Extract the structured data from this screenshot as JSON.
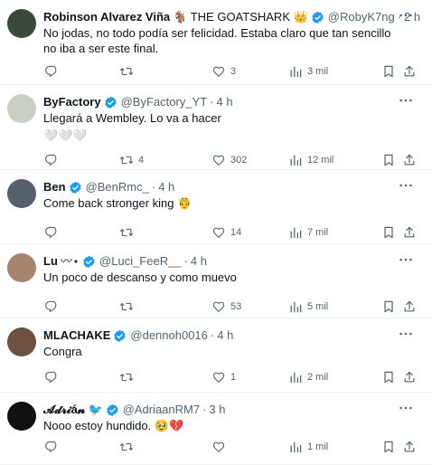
{
  "tweets": [
    {
      "name": "Robinson Alvarez Viña",
      "name_suffix": "🐐 THE GOATSHARK 👑",
      "verified": true,
      "handle": "@RobyK7ng",
      "dot": "·",
      "time": "2 h",
      "text": "No jodas, no todo podía ser felicidad. Estaba claro que tan sencillo no iba a ser este final.",
      "replies": "",
      "retweets": "",
      "likes": "3",
      "views": "3 mil",
      "avatar_color": "#3a4a3a"
    },
    {
      "name": "ByFactory",
      "name_suffix": "",
      "verified": true,
      "handle": "@ByFactory_YT",
      "dot": "·",
      "time": "4 h",
      "text": "Llegará a Wembley. Lo va a hacer",
      "hearts": "🤍🤍🤍",
      "replies": "",
      "retweets": "4",
      "likes": "302",
      "views": "12 mil",
      "avatar_color": "#c9cfc4"
    },
    {
      "name": "Ben",
      "name_suffix": "",
      "verified": true,
      "handle": "@BenRmc_",
      "dot": "·",
      "time": "4 h",
      "text": "Come back stronger king 🤴",
      "replies": "",
      "retweets": "",
      "likes": "14",
      "views": "7 mil",
      "avatar_color": "#56606b"
    },
    {
      "name": "Lu",
      "name_suffix": "〰⋆",
      "verified": true,
      "handle": "@Luci_FeeR__",
      "dot": "·",
      "time": "4 h",
      "text": "Un poco de descanso y como muevo",
      "replies": "",
      "retweets": "",
      "likes": "53",
      "views": "5 mil",
      "avatar_color": "#a58470"
    },
    {
      "name": "MLACHAKE",
      "name_suffix": "",
      "verified": true,
      "handle": "@dennoh0016",
      "dot": "·",
      "time": "4 h",
      "text": "Congra",
      "replies": "",
      "retweets": "",
      "likes": "1",
      "views": "2 mil",
      "avatar_color": "#6e5240"
    },
    {
      "name": "𝓐𝓭𝓻𝓲á𝓷",
      "name_suffix": "🐦",
      "verified": true,
      "handle": "@AdriaanRM7",
      "dot": "·",
      "time": "3 h",
      "text": "Nooo estoy hundido. 🥹💔",
      "replies": "",
      "retweets": "",
      "likes": "",
      "views": "1 mil",
      "avatar_color": "#111111"
    }
  ]
}
